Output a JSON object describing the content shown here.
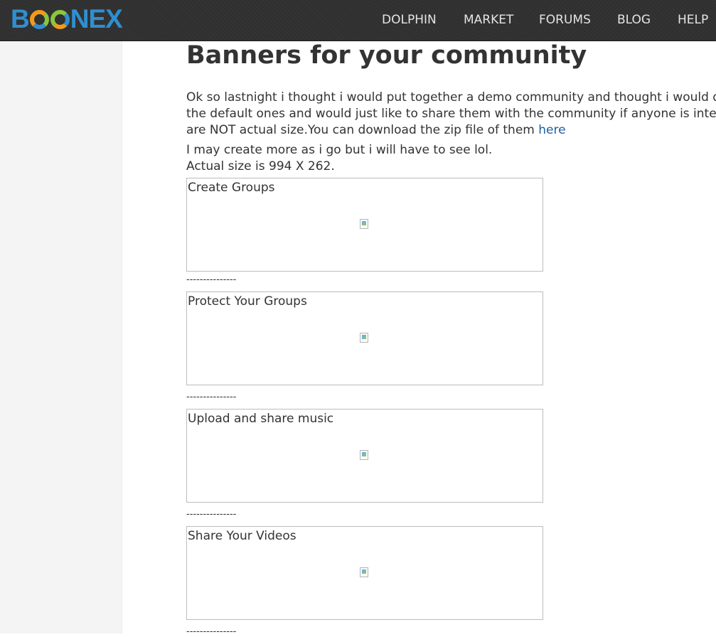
{
  "header": {
    "logo": {
      "b": "B",
      "rest": "NEX"
    },
    "nav": [
      "DOLPHIN",
      "MARKET",
      "FORUMS",
      "BLOG",
      "HELP"
    ]
  },
  "post": {
    "title": "Banners for your community",
    "paragraph_lines": [
      "Ok so lastnight i thought i would put together a demo community and thought i would d",
      "the default ones and would just like to share them with the community if anyone is inter",
      "are NOT actual size.You can download the zip file of them"
    ],
    "link_text": "here",
    "lines2": [
      "I may create more as i go but i will have to see lol.",
      "Actual size is 994 X 262."
    ],
    "banners": [
      "Create Groups",
      "Protect Your Groups",
      "Upload and share music",
      "Share Your Videos"
    ],
    "separator": "---------------"
  }
}
